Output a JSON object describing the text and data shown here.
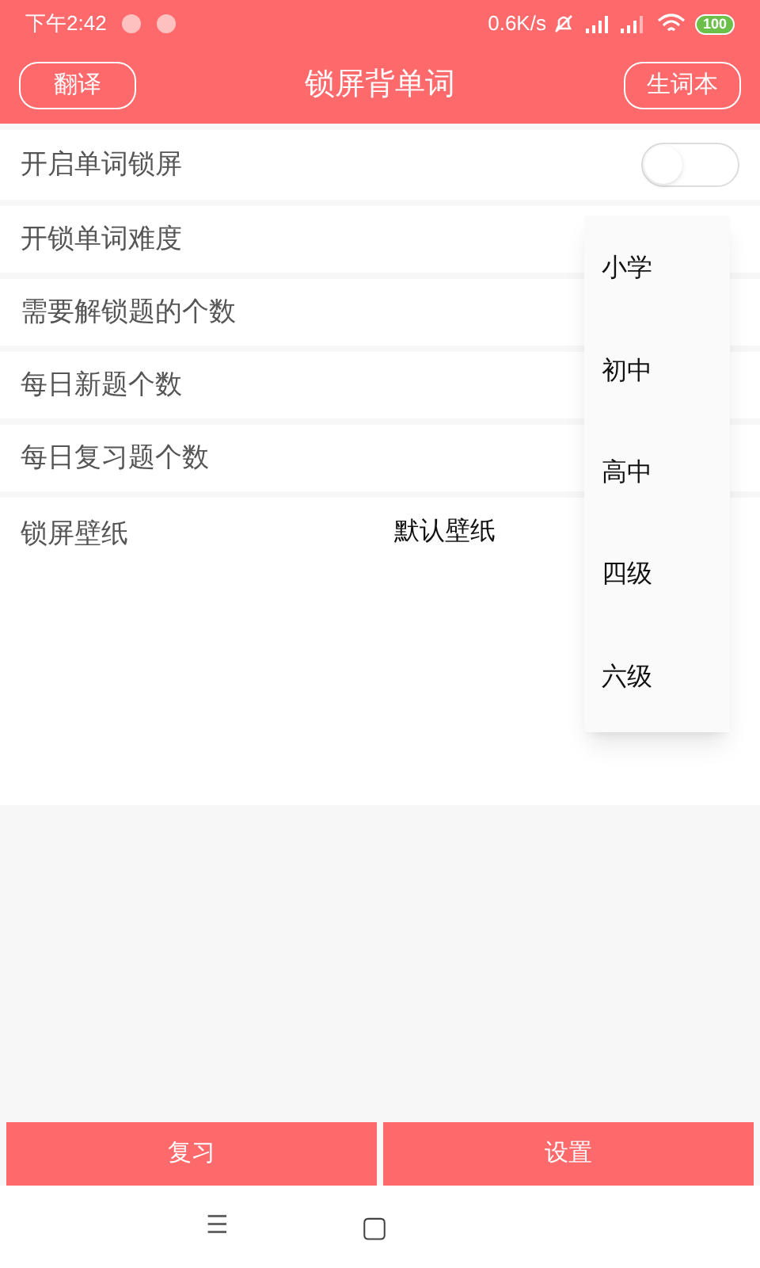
{
  "status_bar": {
    "time": "下午2:42",
    "speed": "0.6K/s",
    "battery": "100"
  },
  "header": {
    "left_button": "翻译",
    "title": "锁屏背单词",
    "right_button": "生词本"
  },
  "settings": [
    {
      "kind": "toggle",
      "label": "开启单词锁屏",
      "on": false
    },
    {
      "kind": "plain",
      "label": "开锁单词难度"
    },
    {
      "kind": "plain",
      "label": "需要解锁题的个数"
    },
    {
      "kind": "plain",
      "label": "每日新题个数"
    },
    {
      "kind": "plain",
      "label": "每日复习题个数"
    },
    {
      "kind": "value",
      "label": "锁屏壁纸",
      "value": "默认壁纸"
    }
  ],
  "dropdown": {
    "options": [
      "小学",
      "初中",
      "高中",
      "四级",
      "六级"
    ]
  },
  "bottom_buttons": [
    "复习",
    "设置"
  ],
  "nav_bar": {
    "menu": "☰",
    "home": "▢"
  }
}
